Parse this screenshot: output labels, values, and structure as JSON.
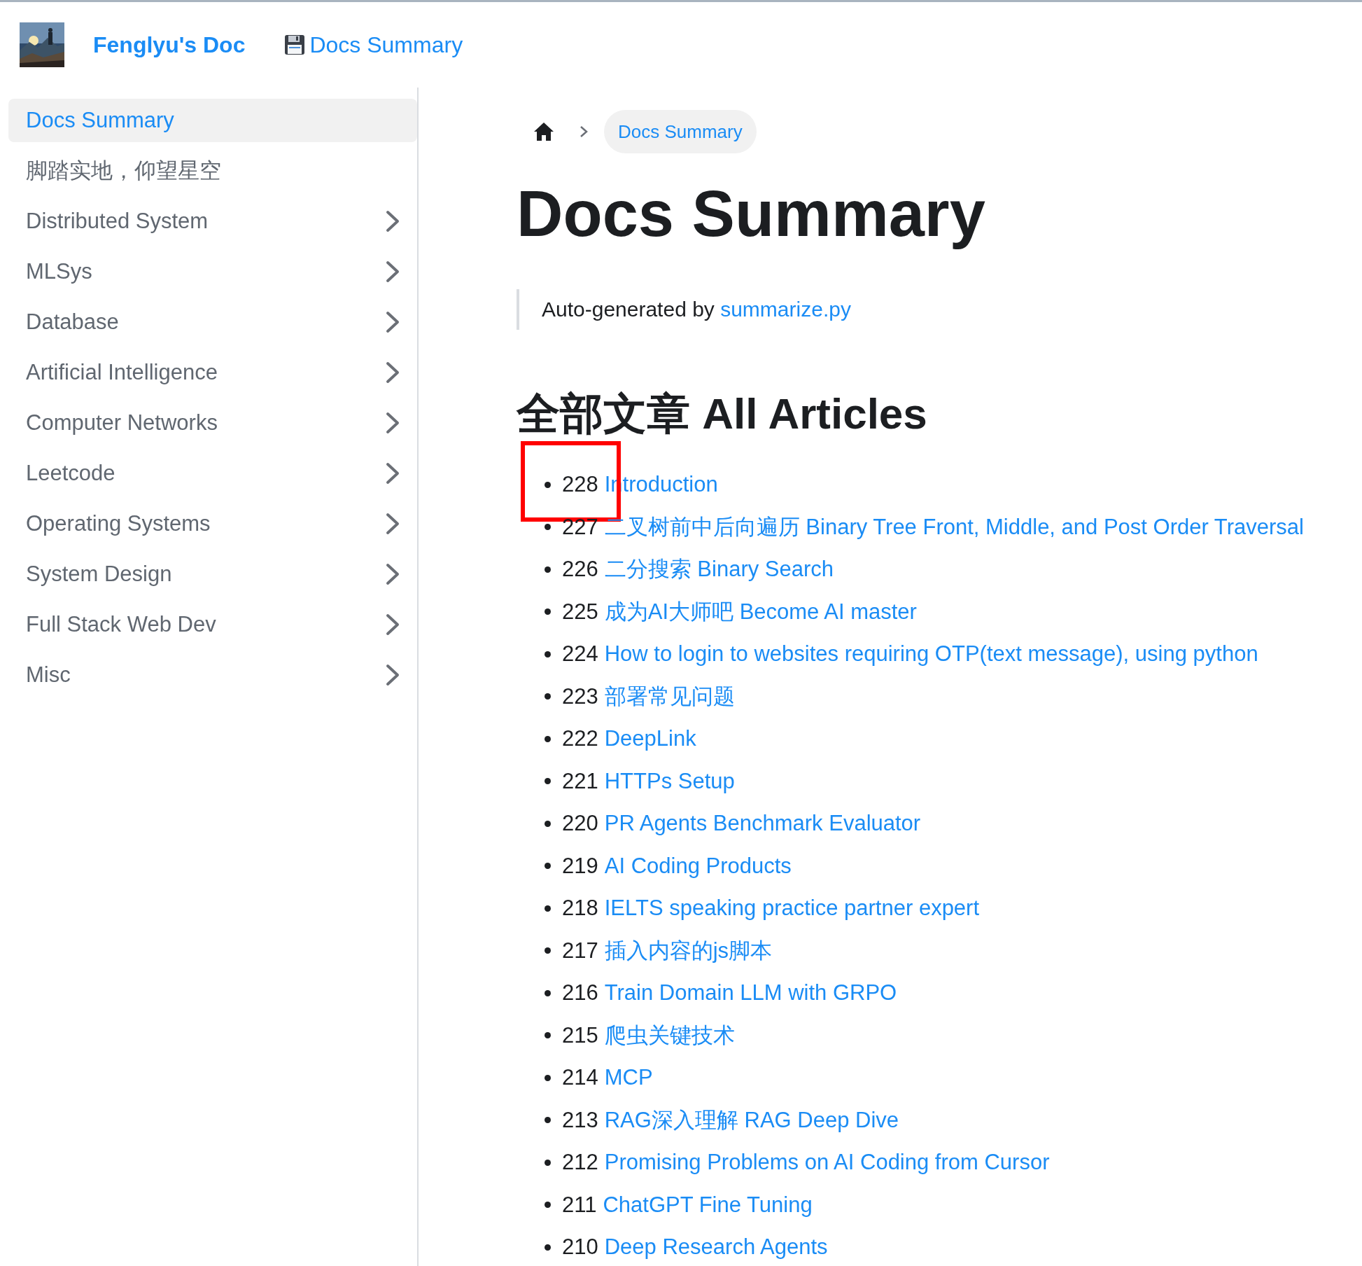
{
  "header": {
    "site_title": "Fenglyu's Doc",
    "nav_link": "Docs Summary"
  },
  "sidebar": {
    "items": [
      {
        "label": "Docs Summary",
        "selected": true,
        "expandable": false
      },
      {
        "label": "脚踏实地，仰望星空",
        "selected": false,
        "expandable": false
      },
      {
        "label": "Distributed System",
        "selected": false,
        "expandable": true
      },
      {
        "label": "MLSys",
        "selected": false,
        "expandable": true
      },
      {
        "label": "Database",
        "selected": false,
        "expandable": true
      },
      {
        "label": "Artificial Intelligence",
        "selected": false,
        "expandable": true
      },
      {
        "label": "Computer Networks",
        "selected": false,
        "expandable": true
      },
      {
        "label": "Leetcode",
        "selected": false,
        "expandable": true
      },
      {
        "label": "Operating Systems",
        "selected": false,
        "expandable": true
      },
      {
        "label": "System Design",
        "selected": false,
        "expandable": true
      },
      {
        "label": "Full Stack Web Dev",
        "selected": false,
        "expandable": true
      },
      {
        "label": "Misc",
        "selected": false,
        "expandable": true
      }
    ]
  },
  "breadcrumb": {
    "current": "Docs Summary"
  },
  "title": "Docs Summary",
  "note": {
    "text": "Auto-generated by",
    "link": "summarize.py"
  },
  "section_title": "全部文章 All Articles",
  "articles": [
    {
      "number": "228",
      "title": "Introduction",
      "highlighted": true
    },
    {
      "number": "227",
      "title": "二叉树前中后向遍历 Binary Tree Front, Middle, and Post Order Traversal",
      "highlighted": false
    },
    {
      "number": "226",
      "title": "二分搜索 Binary Search",
      "highlighted": false
    },
    {
      "number": "225",
      "title": "成为AI大师吧 Become AI master",
      "highlighted": false
    },
    {
      "number": "224",
      "title": "How to login to websites requiring OTP(text message), using python",
      "highlighted": false
    },
    {
      "number": "223",
      "title": "部署常见问题",
      "highlighted": false
    },
    {
      "number": "222",
      "title": "DeepLink",
      "highlighted": false
    },
    {
      "number": "221",
      "title": "HTTPs Setup",
      "highlighted": false
    },
    {
      "number": "220",
      "title": "PR Agents Benchmark Evaluator",
      "highlighted": false
    },
    {
      "number": "219",
      "title": "AI Coding Products",
      "highlighted": false
    },
    {
      "number": "218",
      "title": "IELTS speaking practice partner expert",
      "highlighted": false
    },
    {
      "number": "217",
      "title": "插入内容的js脚本",
      "highlighted": false
    },
    {
      "number": "216",
      "title": "Train Domain LLM with GRPO",
      "highlighted": false
    },
    {
      "number": "215",
      "title": "爬虫关键技术",
      "highlighted": false
    },
    {
      "number": "214",
      "title": "MCP",
      "highlighted": false
    },
    {
      "number": "213",
      "title": "RAG深入理解 RAG Deep Dive",
      "highlighted": false
    },
    {
      "number": "212",
      "title": "Promising Problems on AI Coding from Cursor",
      "highlighted": false
    },
    {
      "number": "211",
      "title": "ChatGPT Fine Tuning",
      "highlighted": false
    },
    {
      "number": "210",
      "title": "Deep Research Agents",
      "highlighted": false
    }
  ]
}
